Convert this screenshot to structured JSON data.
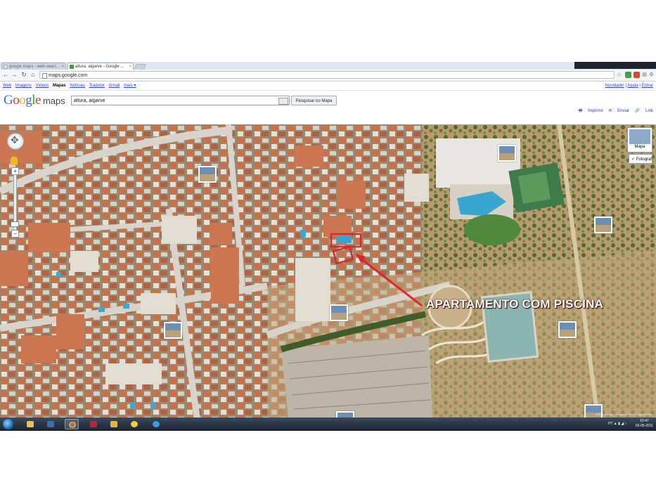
{
  "browser": {
    "tabs": [
      {
        "label": "google maps - web searc..."
      },
      {
        "label": "altura, algarve - Google ..."
      }
    ],
    "url": "maps.google.com"
  },
  "gbar": {
    "left_links": [
      "Web",
      "Imagens",
      "Vídeos",
      "Mapas",
      "Notícias",
      "Tradutor",
      "Gmail",
      "mais ▾"
    ],
    "active": "Mapas",
    "right_links": [
      "Novidade!",
      "Ajuda",
      "Entrar"
    ]
  },
  "header": {
    "logo": "Google",
    "logo_suffix": "maps",
    "search_value": "altura, algarve",
    "search_button": "Pesquisar no Mapa",
    "map_links": [
      "Imprimir",
      "Enviar",
      "Link"
    ]
  },
  "map": {
    "view_buttons": {
      "map": "Mapa",
      "satellite": "Fotograf"
    },
    "annotation": "APARTAMENTO COM PISCINA",
    "copyright": "©2011 Google - Imagens ©2011 DigitalGlobe"
  },
  "taskbar": {
    "time": "10:47",
    "date": "03-05-2011",
    "lang": "PT"
  },
  "colors": {
    "annotation": "#ffffff",
    "highlight": "#e0262b",
    "link": "#2a45b5"
  }
}
